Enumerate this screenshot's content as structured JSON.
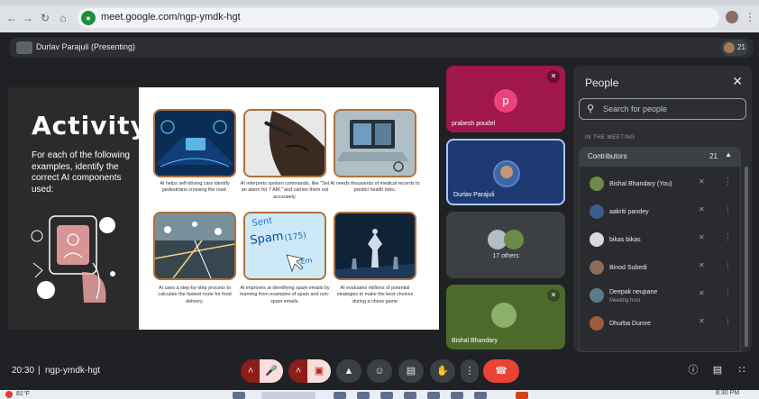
{
  "browser": {
    "url": "meet.google.com/ngp-ymdk-hgt"
  },
  "presenting_bar": {
    "presenter_label": "Durlav Parajuli (Presenting)",
    "participant_count": "21"
  },
  "slide": {
    "title": "Activity",
    "instructions": "For each of the following examples, identify the correct AI components used:",
    "examples": [
      {
        "caption": "AI helps self-driving cars identify pedestrians crossing the road."
      },
      {
        "caption": "AI interprets spoken commands, like \"Set an alarm for 7 AM,\" and carries them out accurately."
      },
      {
        "caption": "AI needs thousands of medical records to predict health risks."
      },
      {
        "caption": "AI uses a step-by-step process to calculate the fastest route for food delivery."
      },
      {
        "caption": "AI improves at identifying spam emails by learning from examples of spam and non-spam emails."
      },
      {
        "caption": "AI evaluates millions of potential strategies to make the best choices during a chess game"
      }
    ],
    "spam_image_words": [
      "Sent",
      "Spam",
      "(175)",
      "Em"
    ]
  },
  "tiles": [
    {
      "name": "prabesh poudel",
      "initial": "p",
      "bg": "#a0174c",
      "avatar_color": "#e9447e"
    },
    {
      "name": "Durlav Parajuli",
      "bg": "#1e3a73"
    },
    {
      "name": "17 others",
      "bg": "#3c4043"
    },
    {
      "name": "Bishal Bhandary",
      "bg": "#4c6b2b"
    }
  ],
  "people_panel": {
    "title": "People",
    "search_placeholder": "Search for people",
    "section_label": "IN THE MEETING",
    "group_label": "Contributors",
    "group_count": "21",
    "participants": [
      {
        "name": "Bishal Bhandary (You)",
        "role": "",
        "avatar_color": "#6d8a4a"
      },
      {
        "name": "aakriti pandey",
        "role": "",
        "avatar_color": "#3b5c8c"
      },
      {
        "name": "bikas bikas",
        "role": "",
        "avatar_color": "#d9d9d9"
      },
      {
        "name": "Binod Subedi",
        "role": "",
        "avatar_color": "#8a6d5a"
      },
      {
        "name": "Deepak neupane",
        "role": "Meeting host",
        "avatar_color": "#5a7b8c"
      },
      {
        "name": "Dhurba Dumre",
        "role": "",
        "avatar_color": "#a05a3c"
      }
    ]
  },
  "bottom_bar": {
    "time": "20:30",
    "separator": "|",
    "meeting_code": "ngp-ymdk-hgt"
  },
  "taskbar": {
    "weather": "81°F",
    "clock": "8:30 PM"
  },
  "colors": {
    "background": "#202124",
    "panel": "#2d2e31",
    "end_call": "#ea4335",
    "muted_button": "#f9dedc"
  }
}
